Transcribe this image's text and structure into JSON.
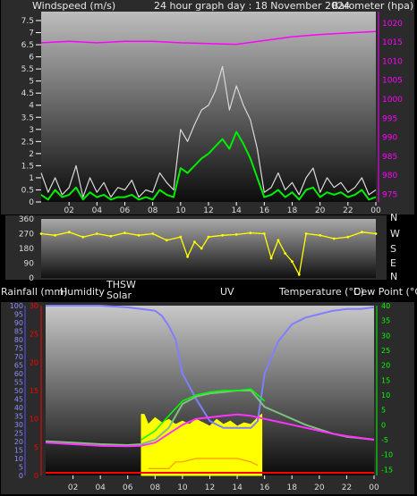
{
  "header": {
    "windspeed_label": "Windspeed (m/s)",
    "graph_title": "24 hour graph day : 18 November 2024",
    "barometer_label": "Barometer (hpa)"
  },
  "lower_header": {
    "rainfall_label": "Rainfall (mm)",
    "humidity_label": "Humidity",
    "thsw_label": "THSW",
    "solar_label": "Solar",
    "uv_label": "UV",
    "temperature_label": "Temperature (°C)",
    "dewpoint_label": "Dew Point (°C)"
  },
  "compass_labels": [
    "N",
    "W",
    "S",
    "E",
    "N"
  ],
  "colors": {
    "barometer": "#ff00ff",
    "windspeed": "#d8d8d8",
    "wind_avg": "#00ee00",
    "direction": "#ffff00",
    "humidity": "#7f7fff",
    "temperature": "#7fc07f",
    "thsw": "#00ff00",
    "dewpoint": "#ff33ff",
    "solar": "#ffff00",
    "uv": "#ff9900",
    "rain": "#ff0000",
    "axis_left_lower": "#5555ff",
    "axis_right_lower": "#00ff00"
  },
  "chart_data": [
    {
      "type": "line",
      "name": "wind_barometer",
      "x_ticks": [
        "02",
        "04",
        "06",
        "08",
        "10",
        "12",
        "14",
        "16",
        "18",
        "20",
        "22",
        "00"
      ],
      "x_range_hours": [
        0,
        24
      ],
      "wind_ticks": [
        "0",
        "0.5",
        "1",
        "1.5",
        "2",
        "2.5",
        "3",
        "3.5",
        "4",
        "4.5",
        "5",
        "5.5",
        "6",
        "6.5",
        "7",
        "7.5"
      ],
      "wind_range": [
        0,
        7.5
      ],
      "baro_ticks": [
        "975",
        "980",
        "985",
        "990",
        "995",
        "1000",
        "1005",
        "1010",
        "1015",
        "1020"
      ],
      "baro_range": [
        973,
        1023
      ],
      "barometer": {
        "x": [
          0,
          2,
          4,
          6,
          8,
          10,
          12,
          14,
          16,
          18,
          20,
          22,
          24
        ],
        "y": [
          1014.8,
          1015.2,
          1014.8,
          1015.2,
          1015.2,
          1014.8,
          1014.6,
          1014.4,
          1015.4,
          1016.4,
          1017.0,
          1017.4,
          1017.8
        ]
      },
      "wind_gust": {
        "x": [
          0,
          0.5,
          1,
          1.5,
          2,
          2.5,
          3,
          3.5,
          4,
          4.5,
          5,
          5.5,
          6,
          6.5,
          7,
          7.5,
          8,
          8.5,
          9,
          9.5,
          10,
          10.5,
          11,
          11.5,
          12,
          12.5,
          13,
          13.5,
          14,
          14.5,
          15,
          15.5,
          16,
          16.5,
          17,
          17.5,
          18,
          18.5,
          19,
          19.5,
          20,
          20.5,
          21,
          21.5,
          22,
          22.5,
          23,
          23.5,
          24
        ],
        "y": [
          1.2,
          0.4,
          1.0,
          0.3,
          0.6,
          1.5,
          0.2,
          1.0,
          0.4,
          0.8,
          0.2,
          0.6,
          0.5,
          0.9,
          0.2,
          0.5,
          0.4,
          1.2,
          0.8,
          0.5,
          3.0,
          2.5,
          3.2,
          3.8,
          4.0,
          4.6,
          5.6,
          3.8,
          4.8,
          4.0,
          3.4,
          2.2,
          0.4,
          0.6,
          1.2,
          0.5,
          0.8,
          0.3,
          1.0,
          1.4,
          0.4,
          1.0,
          0.6,
          0.8,
          0.4,
          0.6,
          1.0,
          0.3,
          0.5
        ]
      },
      "wind_avg": {
        "x": [
          0,
          0.5,
          1,
          1.5,
          2,
          2.5,
          3,
          3.5,
          4,
          4.5,
          5,
          5.5,
          6,
          6.5,
          7,
          7.5,
          8,
          8.5,
          9,
          9.5,
          10,
          10.5,
          11,
          11.5,
          12,
          12.5,
          13,
          13.5,
          14,
          14.5,
          15,
          15.5,
          16,
          16.5,
          17,
          17.5,
          18,
          18.5,
          19,
          19.5,
          20,
          20.5,
          21,
          21.5,
          22,
          22.5,
          23,
          23.5,
          24
        ],
        "y": [
          0.3,
          0.1,
          0.5,
          0.2,
          0.3,
          0.6,
          0.1,
          0.4,
          0.2,
          0.3,
          0.1,
          0.2,
          0.2,
          0.3,
          0.1,
          0.2,
          0.1,
          0.5,
          0.3,
          0.2,
          1.4,
          1.2,
          1.5,
          1.8,
          2.0,
          2.3,
          2.6,
          2.2,
          2.9,
          2.4,
          1.8,
          1.0,
          0.2,
          0.3,
          0.5,
          0.2,
          0.4,
          0.1,
          0.5,
          0.6,
          0.2,
          0.4,
          0.3,
          0.4,
          0.2,
          0.3,
          0.5,
          0.1,
          0.2
        ]
      }
    },
    {
      "type": "scatter",
      "name": "wind_direction",
      "y_ticks": [
        "360",
        "270",
        "180",
        "90",
        "0"
      ],
      "y_range": [
        0,
        360
      ],
      "direction": {
        "x": [
          0,
          1,
          2,
          3,
          4,
          5,
          6,
          7,
          8,
          9,
          10,
          10.5,
          11,
          11.5,
          12,
          13,
          14,
          15,
          16,
          16.5,
          17,
          17.5,
          18,
          18.5,
          19,
          20,
          21,
          22,
          23,
          24
        ],
        "y": [
          270,
          260,
          280,
          250,
          270,
          255,
          275,
          260,
          270,
          230,
          250,
          130,
          220,
          180,
          250,
          260,
          265,
          275,
          270,
          120,
          230,
          150,
          100,
          20,
          270,
          260,
          240,
          250,
          280,
          270
        ]
      }
    },
    {
      "type": "line",
      "name": "weather_lower",
      "left_ticks": [
        "0",
        "5",
        "10",
        "15",
        "20",
        "25",
        "30",
        "35",
        "40",
        "45",
        "50",
        "55",
        "60",
        "65",
        "70",
        "75",
        "80",
        "85",
        "90",
        "95",
        "100"
      ],
      "humidity_range": [
        0,
        100
      ],
      "rain_ticks": [
        "0",
        "5",
        "10",
        "15",
        "20",
        "25",
        "30"
      ],
      "rain_range": [
        0,
        30
      ],
      "temp_ticks": [
        "-15",
        "-10",
        "-5",
        "0",
        "5",
        "10",
        "15",
        "20",
        "25",
        "30",
        "35",
        "40"
      ],
      "temp_range": [
        -17,
        40
      ],
      "humidity": {
        "x": [
          0,
          2,
          4,
          6,
          7,
          8,
          8.5,
          9,
          9.5,
          10,
          11,
          12,
          13,
          14,
          15,
          15.5,
          16,
          17,
          18,
          19,
          20,
          21,
          22,
          23,
          24
        ],
        "y": [
          100,
          100,
          100,
          99,
          98,
          97,
          94,
          88,
          80,
          60,
          45,
          32,
          28,
          28,
          28,
          32,
          60,
          79,
          89,
          93,
          95,
          97,
          98,
          98,
          99
        ]
      },
      "temperature": {
        "x": [
          0,
          2,
          4,
          6,
          7,
          8,
          9,
          10,
          11,
          12,
          13,
          14,
          15,
          16,
          17,
          18,
          19,
          20,
          21,
          22,
          23,
          24
        ],
        "y": [
          -5.5,
          -6,
          -6.5,
          -6.8,
          -6.5,
          -5,
          -1,
          7,
          9.5,
          10.5,
          11,
          11.5,
          11.5,
          6,
          4,
          2,
          0,
          -1.5,
          -3,
          -4,
          -4.5,
          -5
        ]
      },
      "thsw": {
        "x": [
          7,
          8,
          9,
          10,
          11,
          12,
          13,
          14,
          15,
          16
        ],
        "y": [
          -5,
          -2,
          3,
          8,
          10,
          11,
          11.5,
          11.5,
          12,
          8
        ]
      },
      "dewpoint": {
        "x": [
          0,
          2,
          4,
          6,
          7,
          8,
          9,
          10,
          11,
          12,
          13,
          14,
          15,
          16,
          17,
          18,
          19,
          20,
          21,
          22,
          23,
          24
        ],
        "y": [
          -6,
          -6.5,
          -7,
          -7.2,
          -7,
          -6,
          -3,
          0,
          2,
          2.5,
          3,
          3.5,
          3,
          2,
          1,
          0,
          -1,
          -2,
          -3,
          -3.8,
          -4.4,
          -5
        ]
      },
      "solar": {
        "x": [
          7,
          7.2,
          7.5,
          8,
          8.5,
          9,
          9.5,
          10,
          10.5,
          11,
          11.5,
          12,
          12.5,
          13,
          13.5,
          14,
          14.5,
          15,
          15.5,
          15.8
        ],
        "y": [
          36,
          36,
          30,
          34,
          31,
          33,
          30,
          32,
          30,
          33,
          31,
          29,
          33,
          30,
          32,
          29,
          31,
          30,
          34,
          36
        ]
      },
      "uv": {
        "x": [
          7.5,
          9,
          9.5,
          10,
          11,
          12,
          13,
          14,
          15,
          15.5
        ],
        "y": [
          1,
          1,
          3,
          3,
          4,
          4,
          4,
          4,
          3,
          2
        ]
      },
      "rain": {
        "x": [
          0,
          24
        ],
        "y": [
          0,
          0
        ]
      }
    }
  ]
}
